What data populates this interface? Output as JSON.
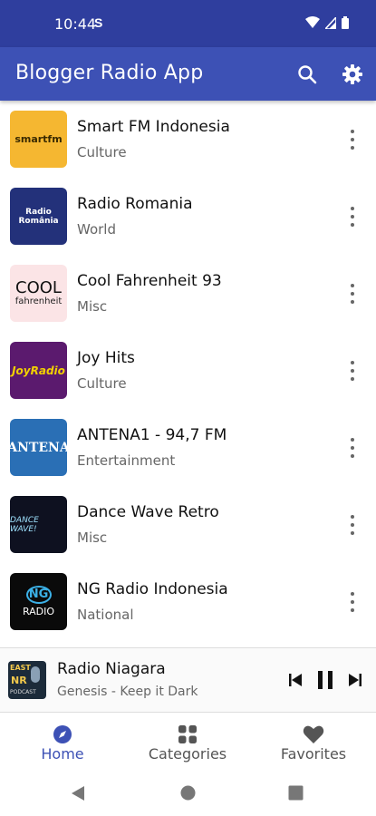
{
  "status_bar": {
    "time": "10:44",
    "s_icon": "S"
  },
  "app_bar": {
    "title": "Blogger Radio App",
    "search_icon": "search-icon",
    "settings_icon": "gear-icon"
  },
  "stations": [
    {
      "name": "Smart FM Indonesia",
      "category": "Culture",
      "logo_text": "smartfm"
    },
    {
      "name": "Radio Romania",
      "category": "World",
      "logo_text": "Radio România"
    },
    {
      "name": "Cool Fahrenheit 93",
      "category": "Misc",
      "logo_text_1": "COOL",
      "logo_text_2": "fahrenheit"
    },
    {
      "name": "Joy Hits",
      "category": "Culture",
      "logo_text": "JoyRadio"
    },
    {
      "name": "ANTENA1 - 94,7 FM",
      "category": "Entertainment",
      "logo_text": "ANTENA"
    },
    {
      "name": "Dance Wave Retro",
      "category": "Misc",
      "logo_text": "DANCE WAVE!"
    },
    {
      "name": "NG Radio Indonesia",
      "category": "National",
      "logo_text_1": "NG",
      "logo_text_2": "RADIO"
    }
  ],
  "player": {
    "title": "Radio Niagara",
    "subtitle": "Genesis - Keep it Dark",
    "art_text_1": "EAST",
    "art_text_2": "NR",
    "art_text_3": "PODCAST"
  },
  "bottom_nav": [
    {
      "label": "Home",
      "icon": "compass-icon",
      "active": true
    },
    {
      "label": "Categories",
      "icon": "grid-icon",
      "active": false
    },
    {
      "label": "Favorites",
      "icon": "heart-icon",
      "active": false
    }
  ],
  "colors": {
    "primary": "#3d51b5",
    "status": "#2f3e9e"
  }
}
